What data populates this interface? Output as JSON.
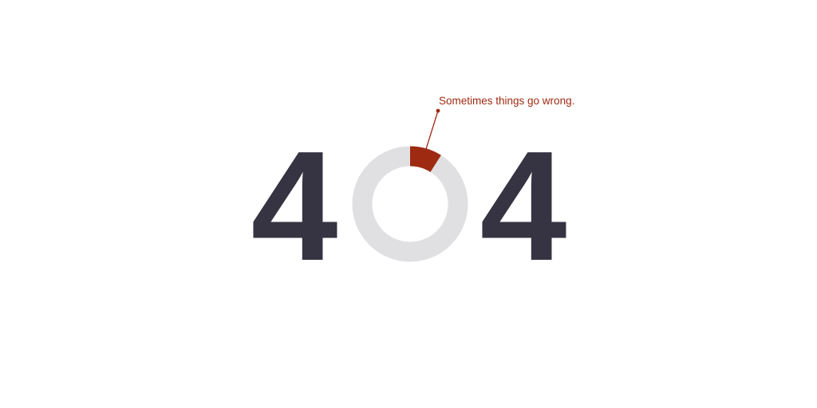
{
  "error_page": {
    "digit_left": "4",
    "digit_right": "4",
    "message": "Sometimes things go wrong.",
    "progress_fraction": 0.09
  },
  "colors": {
    "digit": "#363342",
    "ring_track": "#e0e0e2",
    "ring_accent": "#9e2a12",
    "message_text": "#9e2a12",
    "background": "#ffffff"
  }
}
